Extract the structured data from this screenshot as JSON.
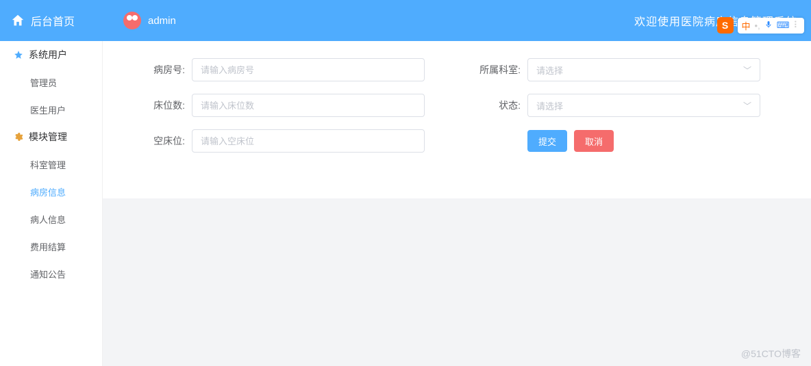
{
  "header": {
    "home_label": "后台首页",
    "username": "admin",
    "welcome": "欢迎使用医院病房信息管理系统"
  },
  "ime": {
    "badge": "S",
    "lang": "中",
    "sep1": "•,",
    "kb_icon": "⌨"
  },
  "sidebar": {
    "items": [
      {
        "label": "系统用户",
        "icon": "star"
      },
      {
        "label": "管理员",
        "sub": true
      },
      {
        "label": "医生用户",
        "sub": true
      },
      {
        "label": "模块管理",
        "icon": "gear"
      },
      {
        "label": "科室管理",
        "sub": true
      },
      {
        "label": "病房信息",
        "sub": true,
        "active": true
      },
      {
        "label": "病人信息",
        "sub": true
      },
      {
        "label": "费用结算",
        "sub": true
      },
      {
        "label": "通知公告",
        "sub": true
      }
    ]
  },
  "form": {
    "room_no": {
      "label": "病房号:",
      "placeholder": "请输入病房号"
    },
    "dept": {
      "label": "所属科室:",
      "placeholder": "请选择"
    },
    "beds": {
      "label": "床位数:",
      "placeholder": "请输入床位数"
    },
    "status": {
      "label": "状态:",
      "placeholder": "请选择"
    },
    "empty": {
      "label": "空床位:",
      "placeholder": "请输入空床位"
    },
    "submit": "提交",
    "cancel": "取消"
  },
  "watermark": "@51CTO博客"
}
